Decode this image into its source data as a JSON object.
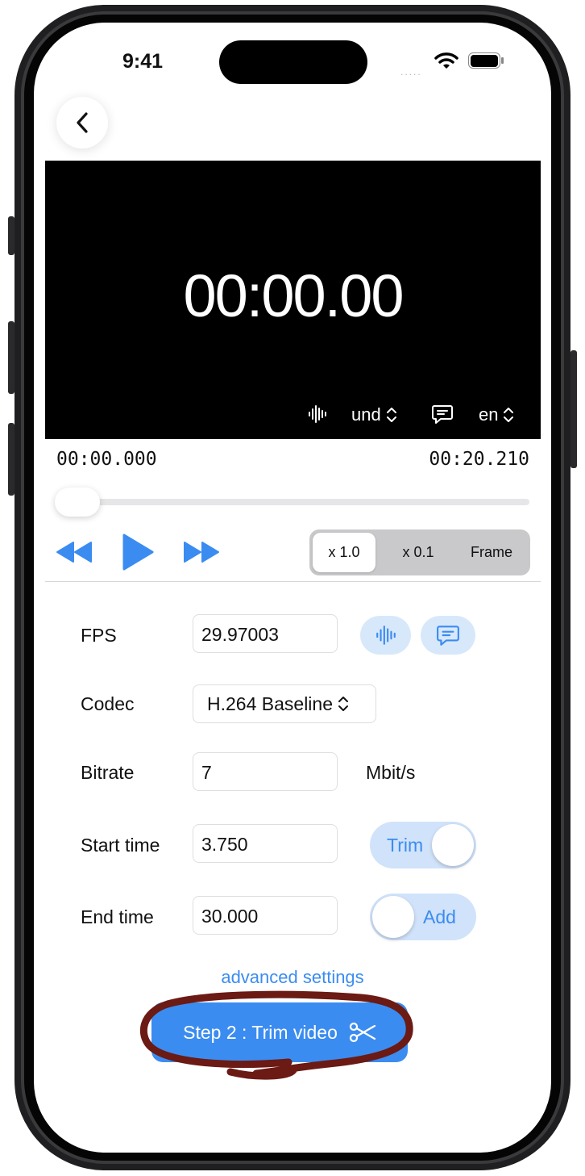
{
  "status_bar": {
    "time": "9:41",
    "signal_dots": "....."
  },
  "player": {
    "timer": "00:00.00",
    "audio_track": "und",
    "subtitle_track": "en",
    "current_time": "00:00.000",
    "duration": "00:20.210",
    "position": 0.0
  },
  "speed_control": {
    "options": [
      "x 1.0",
      "x 0.1",
      "Frame"
    ],
    "selected": "x 1.0"
  },
  "settings": {
    "fps": {
      "label": "FPS",
      "value": "29.97003"
    },
    "codec": {
      "label": "Codec",
      "value": "H.264 Baseline"
    },
    "bitrate": {
      "label": "Bitrate",
      "value": "7",
      "unit": "Mbit/s"
    },
    "start_time": {
      "label": "Start time",
      "value": "3.750",
      "toggle_label": "Trim",
      "toggle_on": true
    },
    "end_time": {
      "label": "End time",
      "value": "30.000",
      "toggle_label": "Add",
      "toggle_on": false
    }
  },
  "advanced_link": "advanced settings",
  "cta_button": {
    "label": "Step 2 : Trim video"
  },
  "colors": {
    "accent": "#3b8cf0",
    "annotation": "#6b1a14"
  }
}
